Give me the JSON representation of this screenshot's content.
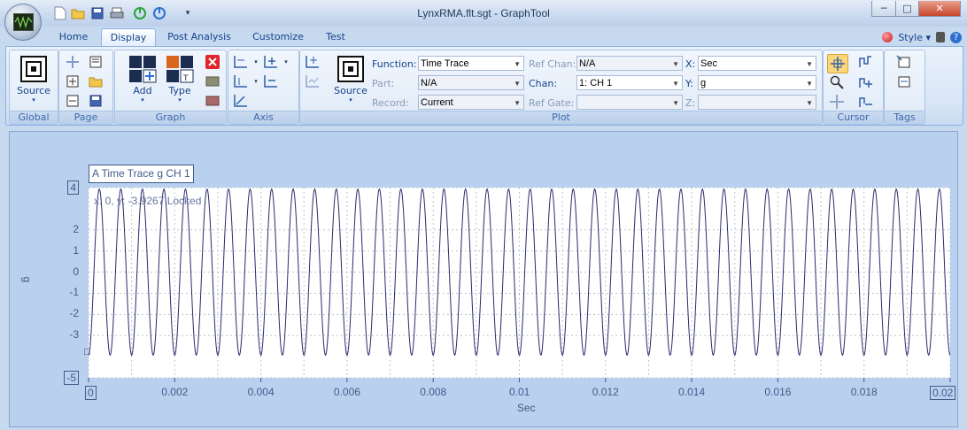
{
  "window": {
    "title": "LynxRMA.flt.sgt - GraphTool",
    "minimize_glyph": "─",
    "maximize_glyph": "□",
    "close_glyph": "✕"
  },
  "quick_access": [
    "new-icon",
    "open-icon",
    "save-icon",
    "print-icon",
    "start-icon",
    "power-icon",
    "customize-dropdown-icon"
  ],
  "tabs": [
    "Home",
    "Display",
    "Post Analysis",
    "Customize",
    "Test"
  ],
  "active_tab": "Display",
  "style_menu": {
    "label": "Style",
    "caret": "▾"
  },
  "ribbon": {
    "groups": {
      "global": "Global",
      "page": "Page",
      "graph": "Graph",
      "axis": "Axis",
      "plot": "Plot",
      "cursor": "Cursor",
      "tags": "Tags"
    },
    "buttons": {
      "source_global": "Source",
      "add": "Add",
      "type": "Type",
      "source_plot": "Source"
    },
    "fields": {
      "function": {
        "label": "Function:",
        "value": "Time Trace"
      },
      "part": {
        "label": "Part:",
        "value": "N/A"
      },
      "record": {
        "label": "Record:",
        "value": "Current"
      },
      "ref_chan": {
        "label": "Ref Chan:",
        "value": "N/A"
      },
      "chan": {
        "label": "Chan:",
        "value": "1: CH 1"
      },
      "ref_gate": {
        "label": "Ref Gate:",
        "value": ""
      },
      "x": {
        "label": "X:",
        "value": "Sec"
      },
      "y": {
        "label": "Y:",
        "value": "g"
      },
      "z": {
        "label": "Z:",
        "value": ""
      }
    }
  },
  "graph": {
    "title_box": "A Time Trace g CH 1",
    "cursor_readout": "x: 0, y: -3.9267 Locked",
    "cursor_glyph": "□",
    "ylabel": "g",
    "xlabel": "Sec",
    "y_ticks": [
      "4",
      "2",
      "1",
      "0",
      "-1",
      "-2",
      "-3",
      "-5"
    ],
    "x_ticks": [
      "0",
      "0.002",
      "0.004",
      "0.006",
      "0.008",
      "0.01",
      "0.012",
      "0.014",
      "0.016",
      "0.018",
      "0.02"
    ]
  },
  "chart_data": {
    "type": "line",
    "title": "A Time Trace g CH 1",
    "xlabel": "Sec",
    "ylabel": "g",
    "xlim": [
      0,
      0.02
    ],
    "ylim": [
      -5,
      4
    ],
    "grid": true,
    "series": [
      {
        "name": "CH 1",
        "waveform": "sine",
        "cycles": 40,
        "amplitude": 3.9267,
        "offset": 0
      }
    ],
    "colors": {
      "trace": "#2d2a6e",
      "plot_bg": "#ffffff",
      "grid": "#b8c4d6"
    }
  }
}
